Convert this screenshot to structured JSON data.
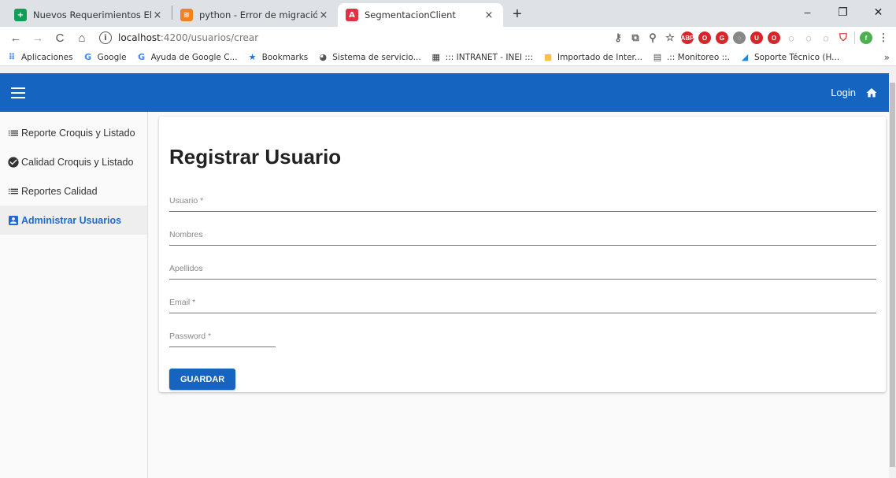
{
  "browser": {
    "tabs": [
      {
        "title": "Nuevos Requerimientos Elegajo",
        "favicon_color": "#0f9d58",
        "favicon": "+"
      },
      {
        "title": "python - Error de migración de D",
        "favicon_color": "#f48024",
        "favicon": "≋"
      },
      {
        "title": "SegmentacionClient",
        "favicon_color": "#dd3343",
        "favicon": "A"
      }
    ],
    "close_glyph": "×",
    "new_tab_glyph": "+",
    "window_controls": {
      "minimize": "–",
      "restore": "❐",
      "close": "✕"
    },
    "url_host": "localhost",
    "url_path": ":4200/usuarios/crear",
    "extensions": [
      "ABP",
      "O",
      "G",
      "◌",
      "U",
      "O",
      "◌",
      "◌",
      "◌"
    ],
    "bookmarks": [
      {
        "label": "Aplicaciones",
        "icon": "apps-icon",
        "color": "#4285f4"
      },
      {
        "label": "Google",
        "icon": "google-icon",
        "color": "#4285f4"
      },
      {
        "label": "Ayuda de Google C...",
        "icon": "google-icon",
        "color": "#4285f4"
      },
      {
        "label": "Bookmarks",
        "icon": "star-icon",
        "color": "#1a73e8"
      },
      {
        "label": "Sistema de servicio...",
        "icon": "globe-icon",
        "color": "#555555"
      },
      {
        "label": "::: INTRANET - INEI :::",
        "icon": "site-icon",
        "color": "#333333"
      },
      {
        "label": "Importado de Inter...",
        "icon": "folder-icon",
        "color": "#f6c342"
      },
      {
        "label": ".:: Monitoreo ::.",
        "icon": "chart-icon",
        "color": "#555555"
      },
      {
        "label": "Soporte Técnico (H...",
        "icon": "support-icon",
        "color": "#1e88e5"
      }
    ],
    "bookmarks_more": "»"
  },
  "app": {
    "primary_color": "#1565c0",
    "login_label": "Login",
    "sidenav": [
      {
        "label": "Reporte Croquis y Listado",
        "icon": "list-icon",
        "active": false
      },
      {
        "label": "Calidad Croquis y Listado",
        "icon": "check-circle-icon",
        "active": false
      },
      {
        "label": "Reportes Calidad",
        "icon": "list-icon",
        "active": false
      },
      {
        "label": "Administrar Usuarios",
        "icon": "account-box-icon",
        "active": true
      }
    ],
    "form": {
      "title": "Registrar Usuario",
      "fields": [
        {
          "label": "Usuario *"
        },
        {
          "label": "Nombres"
        },
        {
          "label": "Apellidos"
        },
        {
          "label": "Email *"
        },
        {
          "label": "Password *"
        }
      ],
      "submit_label": "GUARDAR"
    }
  }
}
